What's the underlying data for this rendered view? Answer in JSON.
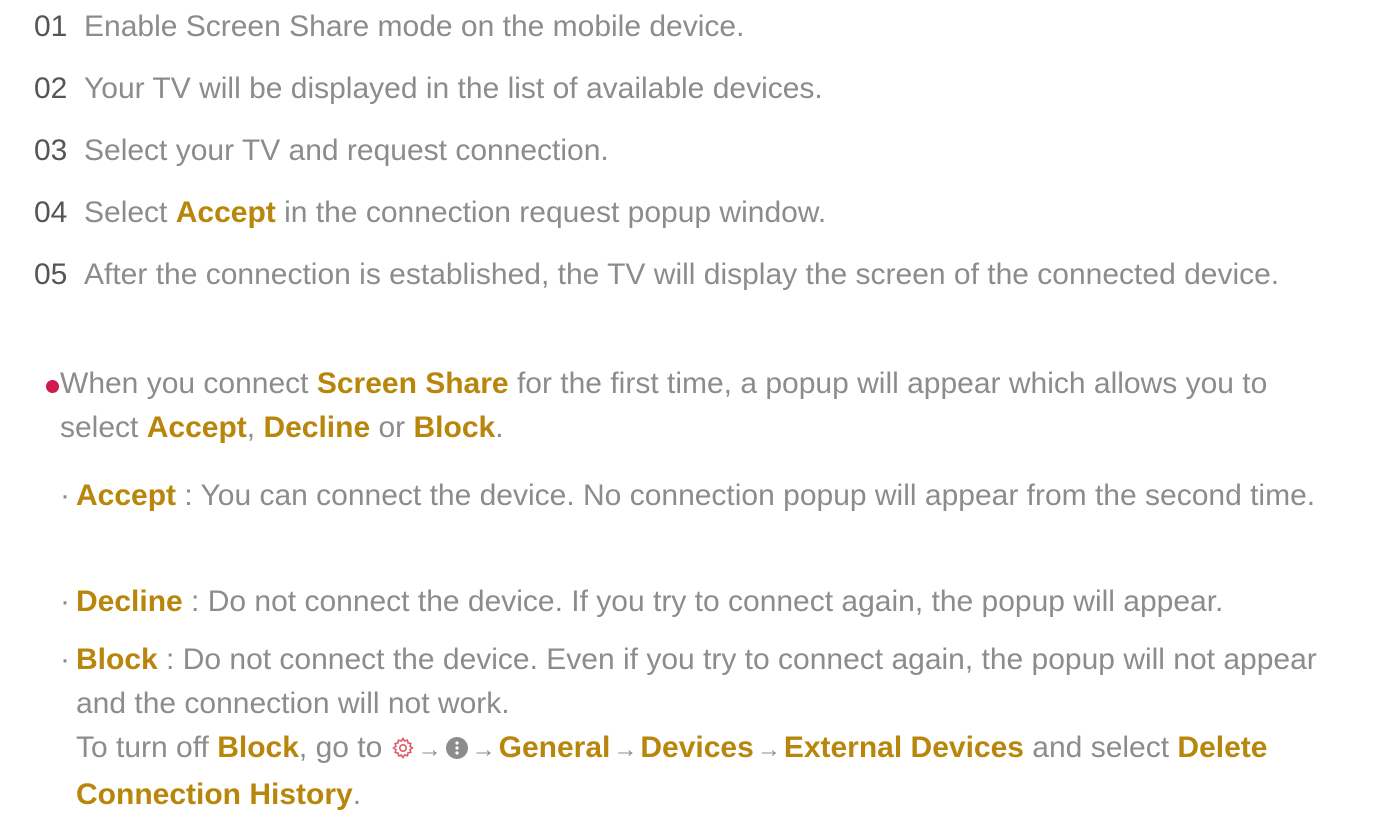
{
  "steps": [
    {
      "num": "01",
      "text": "Enable Screen Share mode on the mobile device."
    },
    {
      "num": "02",
      "text": "Your TV will be displayed in the list of available devices."
    },
    {
      "num": "03",
      "text": "Select your TV and request connection."
    },
    {
      "num": "04",
      "pre": "Select ",
      "hl": "Accept",
      "post": " in the connection request popup window."
    },
    {
      "num": "05",
      "text": "After the connection is established, the TV will display the screen of the connected device."
    }
  ],
  "note": {
    "pre": "When you connect ",
    "screen_share": "Screen Share",
    "mid": " for the first time, a popup will appear which allows you to select ",
    "accept": "Accept",
    "comma": ", ",
    "decline": "Decline",
    "or": " or ",
    "block": "Block",
    "end": "."
  },
  "options": [
    {
      "bullet": "·",
      "label": "Accept",
      "text": " : You can connect the device. No connection popup will appear from the second time."
    },
    {
      "bullet": "·",
      "label": "Decline",
      "text": " : Do not connect the device. If you try to connect again, the popup will appear."
    },
    {
      "bullet": "·",
      "label": "Block",
      "text": " : Do not connect the device. Even if you try to connect again, the popup will not appear and the connection will not work."
    }
  ],
  "turn_off": {
    "pre": "To turn off ",
    "block": "Block",
    "go_to": ", go to ",
    "arrow": "→",
    "general": "General",
    "devices": "Devices",
    "external_devices": "External Devices",
    "and_select": " and select ",
    "delete_history": "Delete Connection History",
    "end": "."
  },
  "icons": {
    "settings": "gear-icon",
    "more": "more-menu-icon"
  },
  "colors": {
    "text": "#8c8c8c",
    "number": "#555555",
    "highlight": "#b8860b",
    "bullet": "#d1184f",
    "settings_icon": "#e05a6a"
  }
}
